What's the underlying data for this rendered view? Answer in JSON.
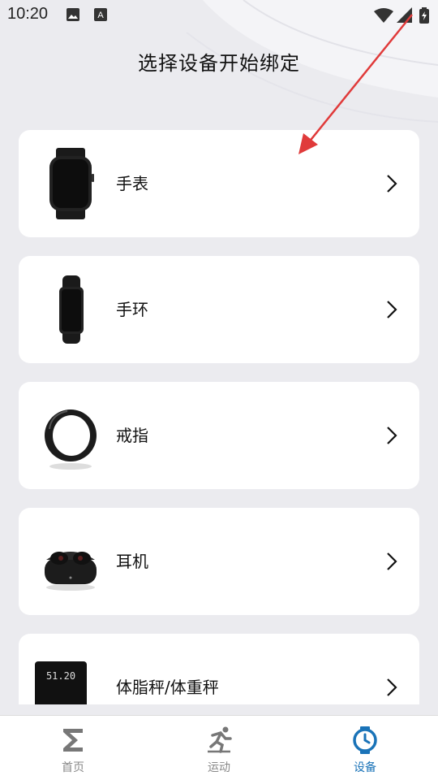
{
  "status_bar": {
    "time": "10:20",
    "left_icons": [
      "image-icon",
      "keyboard-a-icon"
    ],
    "right_icons": [
      "wifi-icon",
      "cell-signal-icon",
      "battery-charging-icon"
    ]
  },
  "page": {
    "title": "选择设备开始绑定"
  },
  "devices": [
    {
      "label": "手表",
      "icon": "watch-icon"
    },
    {
      "label": "手环",
      "icon": "band-icon"
    },
    {
      "label": "戒指",
      "icon": "ring-icon"
    },
    {
      "label": "耳机",
      "icon": "earbuds-icon"
    },
    {
      "label": "体脂秤/体重秤",
      "icon": "scale-icon",
      "scale_reading": "51.20"
    }
  ],
  "bottom_nav": [
    {
      "label": "首页",
      "icon": "sigma-home-icon",
      "active": false
    },
    {
      "label": "运动",
      "icon": "running-icon",
      "active": false
    },
    {
      "label": "设备",
      "icon": "watch-device-icon",
      "active": true
    }
  ],
  "colors": {
    "accent": "#1a73b8",
    "inactive": "#888888",
    "background": "#ebebef",
    "card": "#ffffff",
    "annotation_arrow": "#e03a3a"
  }
}
